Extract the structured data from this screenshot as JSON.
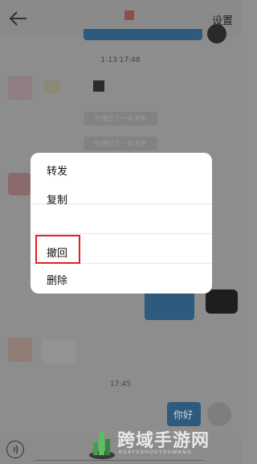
{
  "header": {
    "settings_label": "设置"
  },
  "timestamps": {
    "first": "1-13 17:48",
    "second": "17:45"
  },
  "recall_notices": [
    "你撤回了一条消息",
    "你撤回了一条消息"
  ],
  "context_menu": {
    "items": [
      {
        "label": "转发"
      },
      {
        "label": "复制"
      },
      {
        "label": "撤回"
      },
      {
        "label": "删除"
      }
    ],
    "highlighted_item": "撤回"
  },
  "messages": {
    "last_sent": "你好"
  },
  "watermark": {
    "text": "跨域手游网",
    "pinyin": "KUAYUSHOUYOUWANG"
  },
  "colors": {
    "overlay_gray": "#8d8d8d",
    "bubble_blue": "#2d5a7d",
    "highlight_red": "#e02020",
    "menu_bg": "#ffffff"
  },
  "icons": [
    "back-arrow-icon",
    "voice-icon"
  ]
}
